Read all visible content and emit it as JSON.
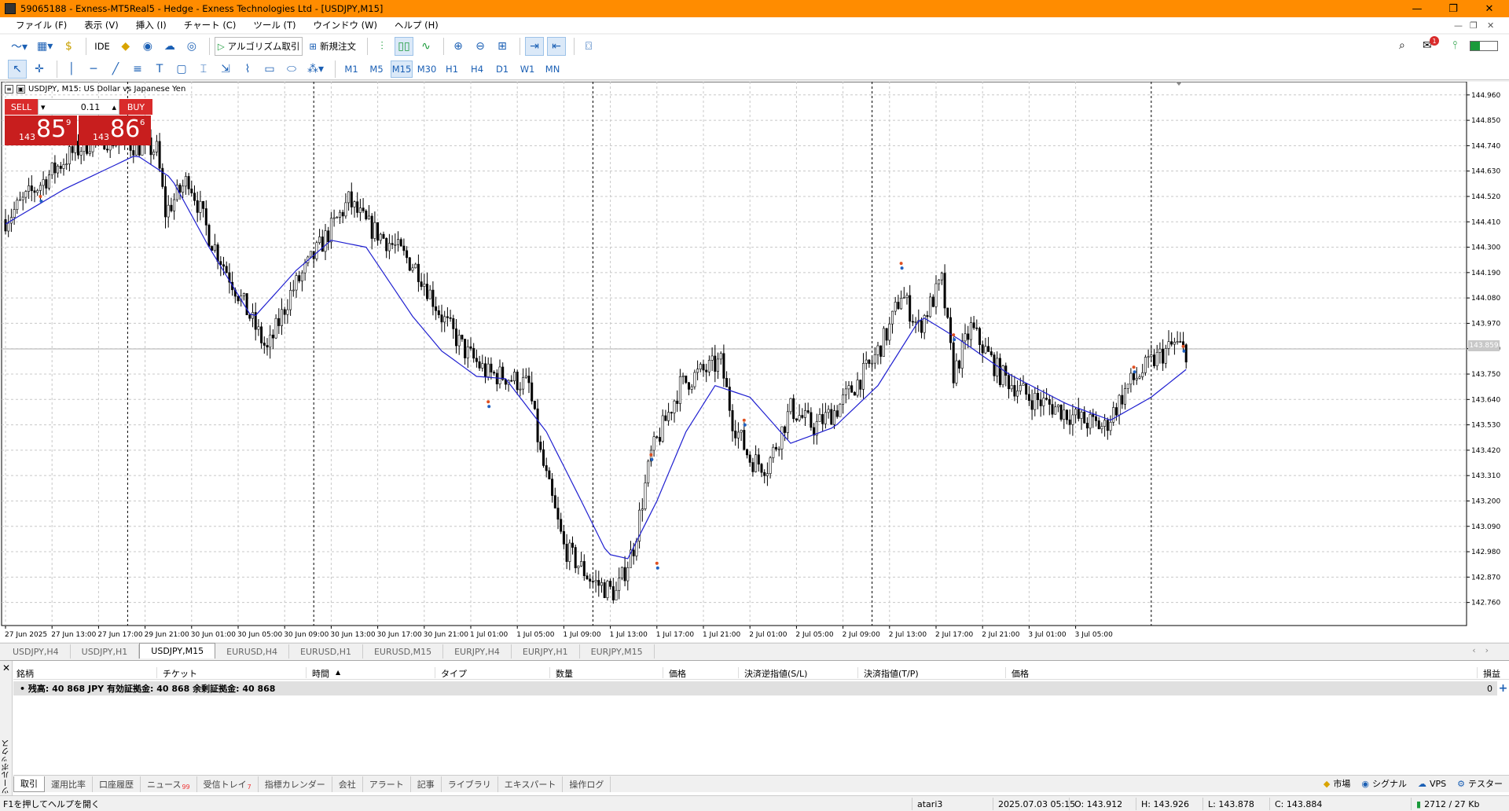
{
  "window": {
    "title": "59065188 - Exness-MT5Real5 - Hedge - Exness Technologies Ltd - [USDJPY,M15]",
    "minimize": "—",
    "maximize": "❐",
    "close": "✕"
  },
  "menu": {
    "items": [
      "ファイル (F)",
      "表示 (V)",
      "挿入 (I)",
      "チャート (C)",
      "ツール (T)",
      "ウインドウ (W)",
      "ヘルプ (H)"
    ],
    "mdi_min": "—",
    "mdi_restore": "❐",
    "mdi_close": "✕"
  },
  "toolbar": {
    "ide_label": "IDE",
    "algo_label": "アルゴリズム取引",
    "new_order_label": "新規注文",
    "notification_count": "1"
  },
  "timeframes": [
    "M1",
    "M5",
    "M15",
    "M30",
    "H1",
    "H4",
    "D1",
    "W1",
    "MN"
  ],
  "timeframe_active": "M15",
  "chart": {
    "header": "USDJPY, M15:  US Dollar vs Japanese Yen",
    "one_click": {
      "sell_label": "SELL",
      "buy_label": "BUY",
      "lot": "0.11",
      "bid_small": "143",
      "bid_big": "85",
      "bid_sup": "9",
      "ask_small": "143",
      "ask_big": "86",
      "ask_sup": "6"
    },
    "current_price_label": "143.859"
  },
  "chart_data": {
    "type": "candlestick",
    "symbol": "USDJPY",
    "timeframe": "M15",
    "y_ticks": [
      "144.960",
      "144.850",
      "144.740",
      "144.630",
      "144.520",
      "144.410",
      "144.300",
      "144.190",
      "144.080",
      "143.970",
      "143.860",
      "143.750",
      "143.640",
      "143.530",
      "143.420",
      "143.310",
      "143.200",
      "143.090",
      "142.980",
      "142.870",
      "142.760"
    ],
    "ylim": [
      142.66,
      144.99
    ],
    "x_labels": [
      "27 Jun 2025",
      "27 Jun 13:00",
      "27 Jun 17:00",
      "29 Jun 21:00",
      "30 Jun 01:00",
      "30 Jun 05:00",
      "30 Jun 09:00",
      "30 Jun 13:00",
      "30 Jun 17:00",
      "30 Jun 21:00",
      "1 Jul 01:00",
      "1 Jul 05:00",
      "1 Jul 09:00",
      "1 Jul 13:00",
      "1 Jul 17:00",
      "1 Jul 21:00",
      "2 Jul 01:00",
      "2 Jul 05:00",
      "2 Jul 09:00",
      "2 Jul 13:00",
      "2 Jul 17:00",
      "2 Jul 21:00",
      "3 Jul 01:00",
      "3 Jul 05:00"
    ],
    "close_path": [
      [
        0,
        144.42
      ],
      [
        10,
        144.55
      ],
      [
        22,
        144.7
      ],
      [
        32,
        144.78
      ],
      [
        42,
        144.75
      ],
      [
        52,
        144.72
      ],
      [
        55,
        144.45
      ],
      [
        63,
        144.6
      ],
      [
        70,
        144.35
      ],
      [
        80,
        144.1
      ],
      [
        90,
        143.85
      ],
      [
        98,
        144.1
      ],
      [
        112,
        144.38
      ],
      [
        118,
        144.5
      ],
      [
        124,
        144.4
      ],
      [
        134,
        144.3
      ],
      [
        142,
        144.2
      ],
      [
        150,
        144.0
      ],
      [
        158,
        143.85
      ],
      [
        166,
        143.75
      ],
      [
        172,
        143.74
      ],
      [
        180,
        143.7
      ],
      [
        184,
        143.4
      ],
      [
        192,
        143.0
      ],
      [
        202,
        142.85
      ],
      [
        210,
        142.8
      ],
      [
        216,
        143.0
      ],
      [
        222,
        143.4
      ],
      [
        232,
        143.7
      ],
      [
        238,
        143.75
      ],
      [
        246,
        143.8
      ],
      [
        250,
        143.55
      ],
      [
        256,
        143.38
      ],
      [
        262,
        143.35
      ],
      [
        270,
        143.6
      ],
      [
        278,
        143.52
      ],
      [
        286,
        143.6
      ],
      [
        298,
        143.8
      ],
      [
        304,
        143.95
      ],
      [
        308,
        144.1
      ],
      [
        314,
        143.95
      ],
      [
        322,
        144.15
      ],
      [
        326,
        143.75
      ],
      [
        332,
        143.95
      ],
      [
        342,
        143.75
      ],
      [
        352,
        143.65
      ],
      [
        362,
        143.6
      ],
      [
        370,
        143.55
      ],
      [
        378,
        143.52
      ],
      [
        386,
        143.7
      ],
      [
        394,
        143.8
      ],
      [
        402,
        143.88
      ],
      [
        406,
        143.85
      ]
    ],
    "ma_path": [
      [
        0,
        144.4
      ],
      [
        20,
        144.55
      ],
      [
        45,
        144.7
      ],
      [
        57,
        144.6
      ],
      [
        70,
        144.3
      ],
      [
        85,
        143.99
      ],
      [
        100,
        144.2
      ],
      [
        112,
        144.33
      ],
      [
        124,
        144.3
      ],
      [
        140,
        144.0
      ],
      [
        150,
        143.85
      ],
      [
        162,
        143.74
      ],
      [
        172,
        143.73
      ],
      [
        186,
        143.5
      ],
      [
        198,
        143.2
      ],
      [
        207,
        142.97
      ],
      [
        214,
        142.95
      ],
      [
        224,
        143.2
      ],
      [
        234,
        143.5
      ],
      [
        244,
        143.7
      ],
      [
        256,
        143.65
      ],
      [
        270,
        143.45
      ],
      [
        285,
        143.52
      ],
      [
        300,
        143.7
      ],
      [
        315,
        144.0
      ],
      [
        328,
        143.9
      ],
      [
        345,
        143.75
      ],
      [
        365,
        143.62
      ],
      [
        380,
        143.55
      ],
      [
        394,
        143.65
      ],
      [
        406,
        143.77
      ]
    ],
    "current_price": 143.859
  },
  "chart_tabs": [
    "USDJPY,H4",
    "USDJPY,H1",
    "USDJPY,M15",
    "EURUSD,H4",
    "EURUSD,H1",
    "EURUSD,M15",
    "EURJPY,H4",
    "EURJPY,H1",
    "EURJPY,M15"
  ],
  "chart_tab_active": "USDJPY,M15",
  "toolbox": {
    "close": "✕",
    "side_label": "ツールボックス",
    "columns": [
      "銘柄",
      "チケット",
      "時間",
      "タイプ",
      "数量",
      "価格",
      "決済逆指値(S/L)",
      "決済指値(T/P)",
      "価格",
      "損益"
    ],
    "sort_arrow": "▲",
    "balance_text": "•  残高: 40 868 JPY  有効証拠金: 40 868  余剰証拠金: 40 868",
    "balance_profit": "0",
    "plus": "+",
    "tabs": [
      {
        "label": "取引",
        "badge": ""
      },
      {
        "label": "運用比率",
        "badge": ""
      },
      {
        "label": "口座履歴",
        "badge": ""
      },
      {
        "label": "ニュース",
        "badge": "99"
      },
      {
        "label": "受信トレイ",
        "badge": "7"
      },
      {
        "label": "指標カレンダー",
        "badge": ""
      },
      {
        "label": "会社",
        "badge": ""
      },
      {
        "label": "アラート",
        "badge": ""
      },
      {
        "label": "記事",
        "badge": ""
      },
      {
        "label": "ライブラリ",
        "badge": ""
      },
      {
        "label": "エキスパート",
        "badge": ""
      },
      {
        "label": "操作ログ",
        "badge": ""
      }
    ],
    "right": [
      "市場",
      "シグナル",
      "VPS",
      "テスター"
    ]
  },
  "status": {
    "help": "F1を押してヘルプを開く",
    "profile": "atari3",
    "datetime": "2025.07.03 05:15",
    "open": "O: 143.912",
    "high": "H: 143.926",
    "low": "L: 143.878",
    "close": "C: 143.884",
    "traffic": "2712 / 27 Kb"
  },
  "colors": {
    "titlebar": "#ff8c00",
    "sell_red": "#d92b2b",
    "ma_line": "#1f1fd0",
    "candle": "#000000"
  }
}
